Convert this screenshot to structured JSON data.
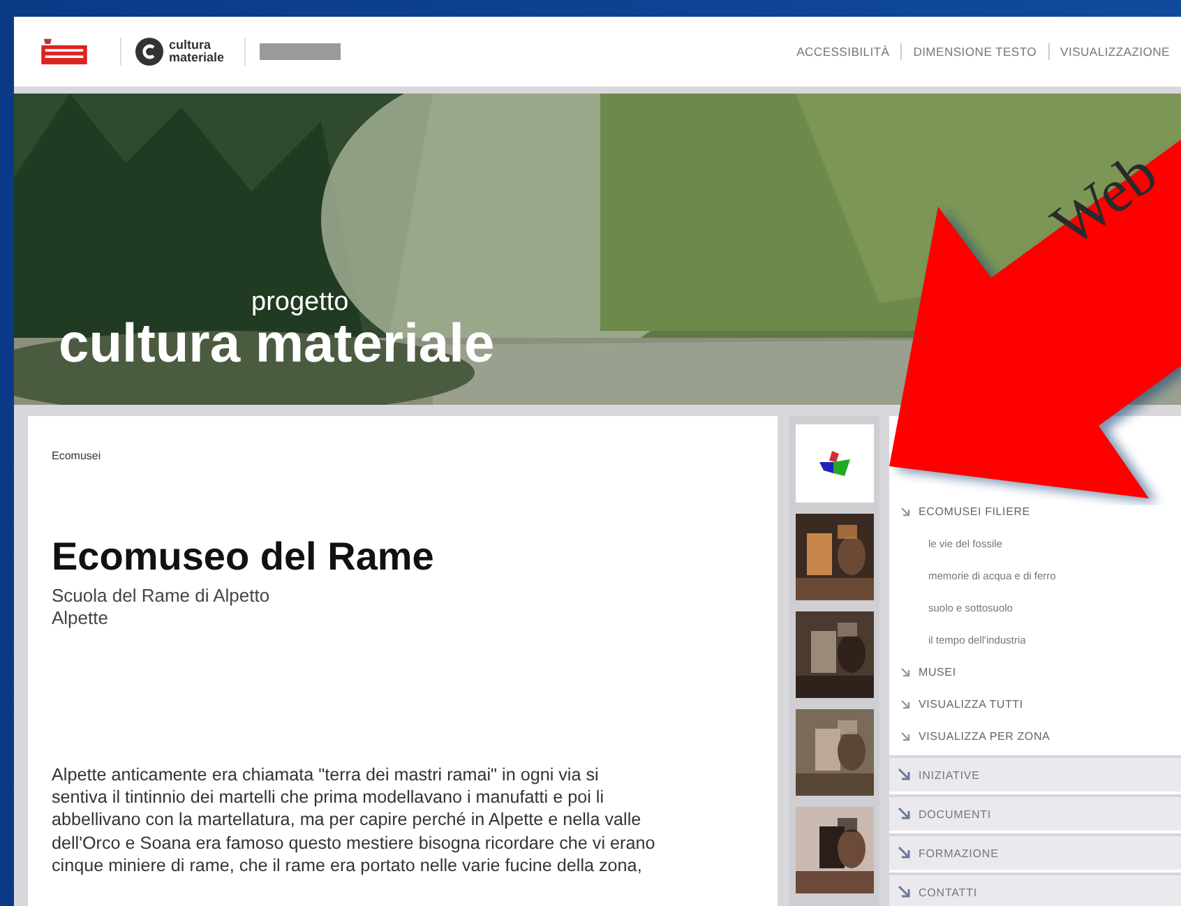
{
  "header": {
    "logo_text": "cultura materiale",
    "nav": [
      "ACCESSIBILITÀ",
      "DIMENSIONE TESTO",
      "VISUALIZZAZIONE"
    ]
  },
  "hero": {
    "kicker": "progetto",
    "title": "cultura materiale"
  },
  "content": {
    "breadcrumb": "Ecomusei",
    "title": "Ecomuseo del Rame",
    "subtitle_lines": [
      "Scuola del Rame di Alpetto",
      "Alpette"
    ],
    "paragraph": "Alpette anticamente era chiamata \"terra dei mastri ramai\" in ogni via si\nsentiva il tintinnio dei martelli che prima modellavano i manufatti e poi li\nabbellivano con la martellatura, ma per capire perché in Alpette e nella valle\ndell'Orco e Soana era famoso questo mestiere bisogna ricordare che vi erano\ncinque miniere di rame, che il rame era portato nelle varie fucine della zona,"
  },
  "menu": [
    {
      "kind": "item",
      "label": "ECOMUSEI FILIERE",
      "children": [
        {
          "label": "le vie del fossile"
        },
        {
          "label": "memorie di acqua e di ferro"
        },
        {
          "label": "suolo e sottosuolo"
        },
        {
          "label": "il tempo dell'industria"
        }
      ]
    },
    {
      "kind": "item",
      "label": "MUSEI"
    },
    {
      "kind": "item",
      "label": "VISUALIZZA TUTTI"
    },
    {
      "kind": "item",
      "label": "VISUALIZZA PER ZONA"
    },
    {
      "kind": "section",
      "label": "INIZIATIVE"
    },
    {
      "kind": "section",
      "label": "DOCUMENTI"
    },
    {
      "kind": "section",
      "label": "FORMAZIONE"
    },
    {
      "kind": "section",
      "label": "CONTATTI"
    }
  ],
  "overlay": {
    "callout": "Web"
  }
}
